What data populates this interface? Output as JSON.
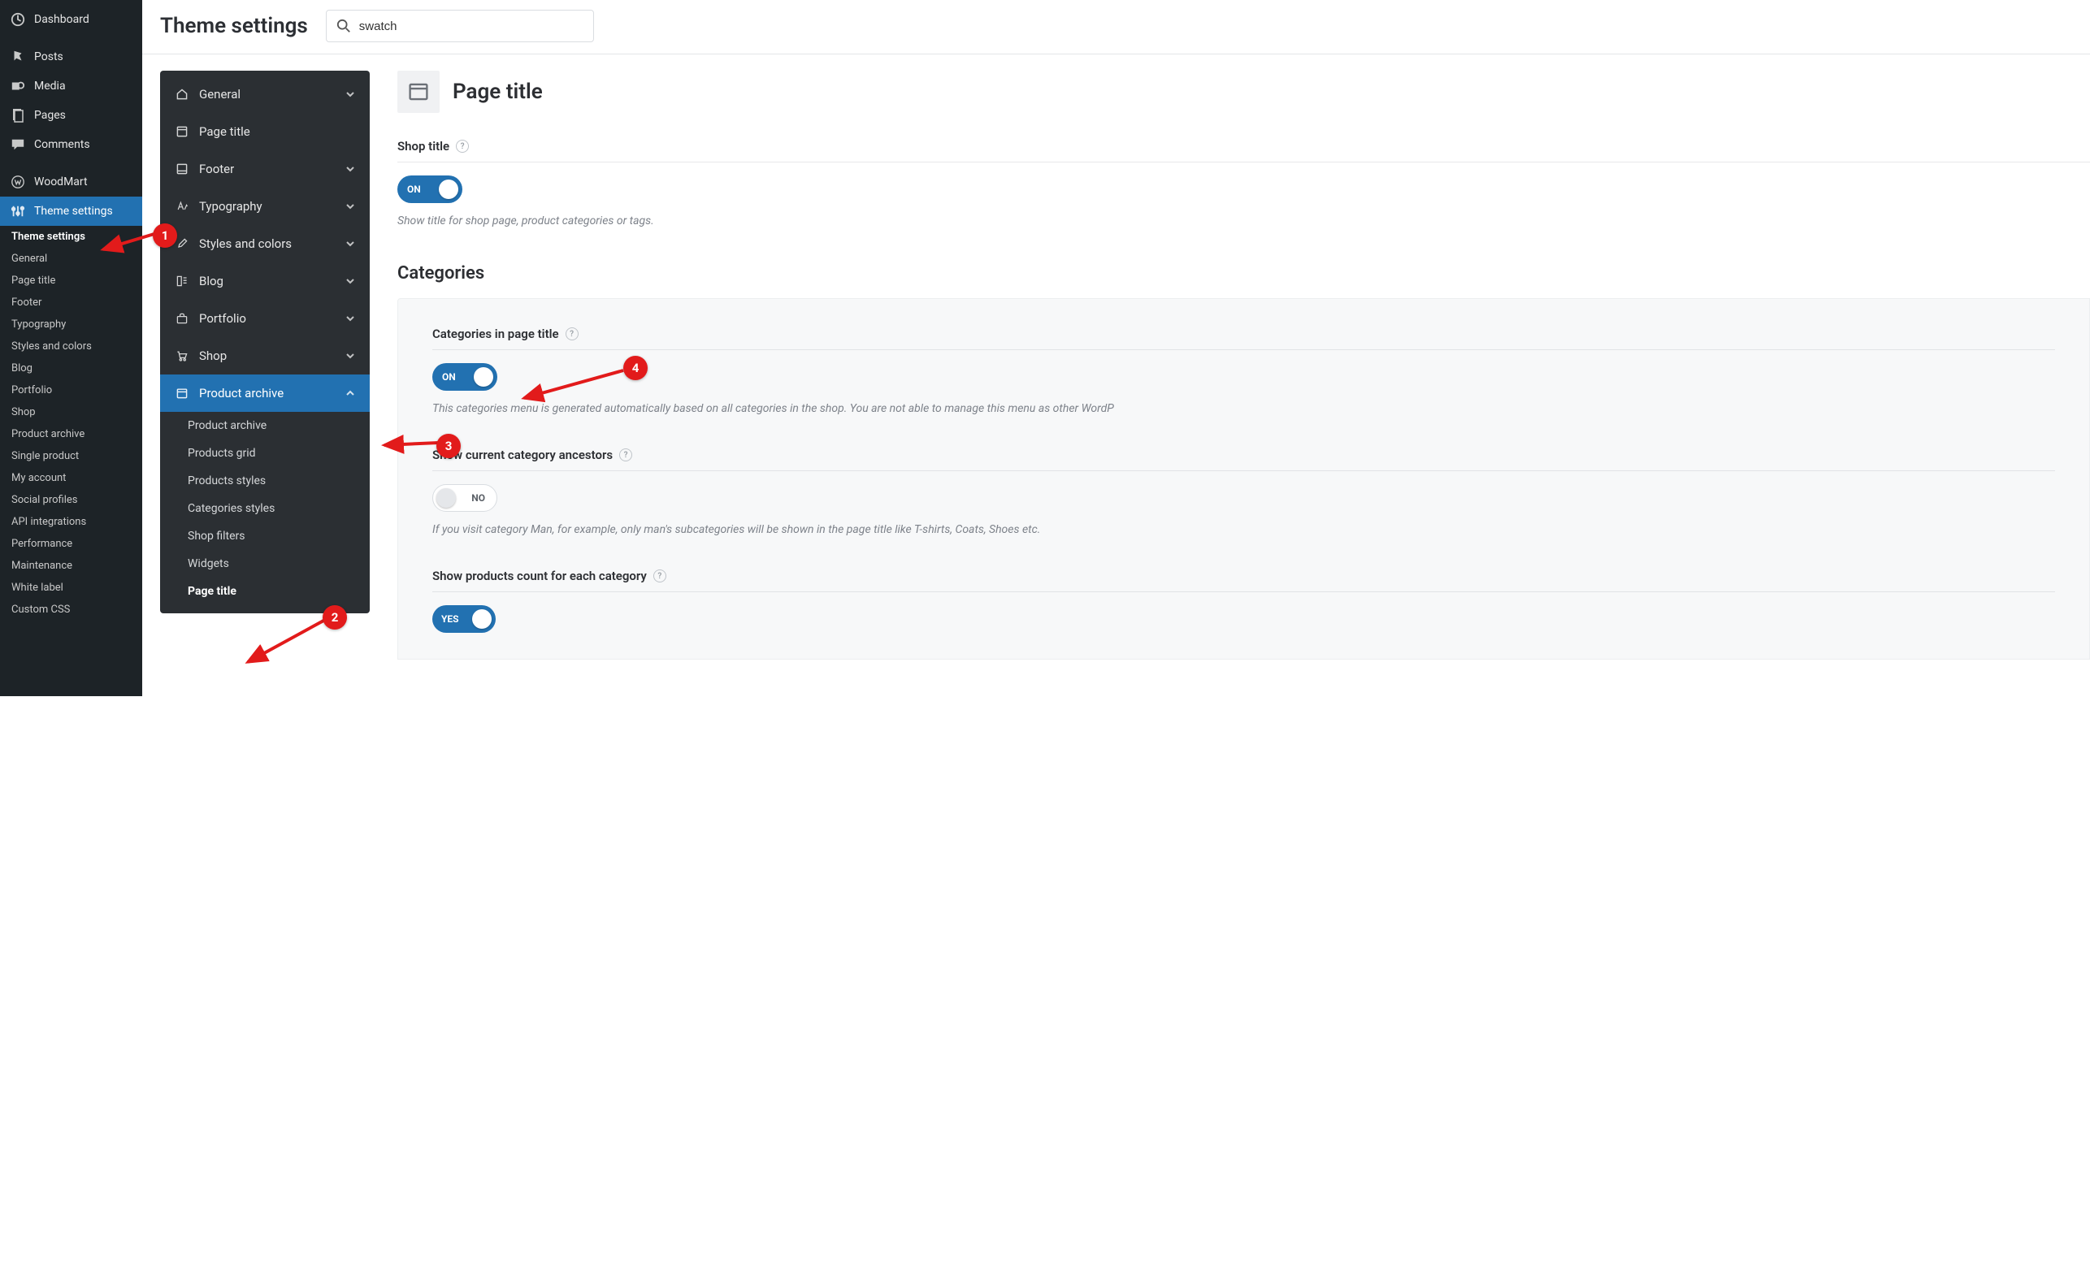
{
  "wp_menu": {
    "dashboard": "Dashboard",
    "posts": "Posts",
    "media": "Media",
    "pages": "Pages",
    "comments": "Comments",
    "woodmart": "WoodMart",
    "theme_settings": "Theme settings"
  },
  "wp_submenu": [
    "Theme settings",
    "General",
    "Page title",
    "Footer",
    "Typography",
    "Styles and colors",
    "Blog",
    "Portfolio",
    "Shop",
    "Product archive",
    "Single product",
    "My account",
    "Social profiles",
    "API integrations",
    "Performance",
    "Maintenance",
    "White label",
    "Custom CSS"
  ],
  "header": {
    "title": "Theme settings",
    "search_value": "swatch"
  },
  "settings_nav": {
    "items": [
      {
        "label": "General",
        "chev": "down"
      },
      {
        "label": "Page title"
      },
      {
        "label": "Footer",
        "chev": "down"
      },
      {
        "label": "Typography",
        "chev": "down"
      },
      {
        "label": "Styles and colors",
        "chev": "down"
      },
      {
        "label": "Blog",
        "chev": "down"
      },
      {
        "label": "Portfolio",
        "chev": "down"
      },
      {
        "label": "Shop",
        "chev": "down"
      },
      {
        "label": "Product archive",
        "chev": "up",
        "selected": true
      }
    ],
    "sub": [
      "Product archive",
      "Products grid",
      "Products styles",
      "Categories styles",
      "Shop filters",
      "Widgets",
      "Page title"
    ]
  },
  "page": {
    "title": "Page title",
    "shop_title_label": "Shop title",
    "shop_title_toggle": "ON",
    "shop_title_desc": "Show title for shop page, product categories or tags.",
    "categories_heading": "Categories",
    "cat_in_title_label": "Categories in page title",
    "cat_in_title_toggle": "ON",
    "cat_in_title_desc": "This categories menu is generated automatically based on all categories in the shop. You are not able to manage this menu as other WordP",
    "ancestors_label": "Show current category ancestors",
    "ancestors_toggle": "NO",
    "ancestors_desc": "If you visit category Man, for example, only man's subcategories will be shown in the page title like T-shirts, Coats, Shoes etc.",
    "count_label": "Show products count for each category",
    "count_toggle": "YES"
  },
  "markers": {
    "m1": "1",
    "m2": "2",
    "m3": "3",
    "m4": "4"
  }
}
